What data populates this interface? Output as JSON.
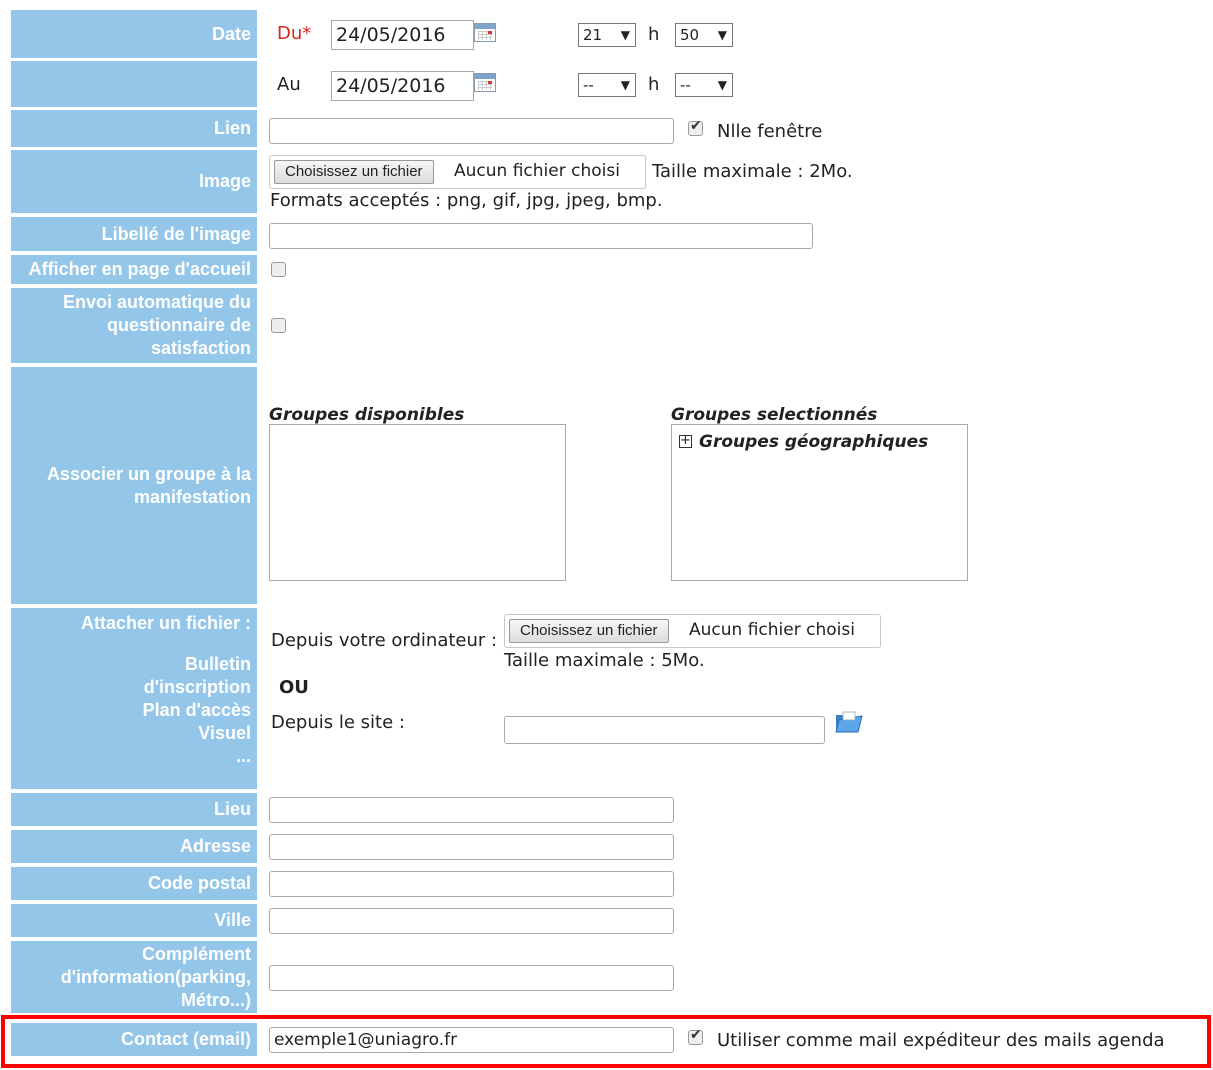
{
  "labels": {
    "date": "Date",
    "lien": "Lien",
    "image": "Image",
    "libelle_image": "Libellé de l'image",
    "afficher": "Afficher en page d'accueil",
    "envoi": [
      "Envoi automatique du",
      "questionnaire de",
      "satisfaction"
    ],
    "associer": [
      "Associer un groupe à la",
      "manifestation"
    ],
    "attacher": "Attacher un fichier :",
    "attacher_types": [
      "Bulletin",
      "d'inscription",
      "Plan d'accès",
      "Visuel",
      "..."
    ],
    "lieu": "Lieu",
    "adresse": "Adresse",
    "code_postal": "Code postal",
    "ville": "Ville",
    "complement": [
      "Complément",
      "d'information(parking,",
      "Métro...)"
    ],
    "contact": "Contact (email)"
  },
  "date": {
    "du_label": "Du*",
    "du_value": "24/05/2016",
    "du_hour": "21",
    "du_min": "50",
    "au_label": "Au",
    "au_value": "24/05/2016",
    "au_hour": "--",
    "au_min": "--",
    "h_sep": "h",
    "arrow": "▼"
  },
  "lien": {
    "value": "",
    "new_window_label": "Nlle fenêtre",
    "new_window_checked": true
  },
  "image": {
    "button": "Choisissez un fichier",
    "no_file": "Aucun fichier choisi",
    "max_size": "Taille maximale : 2Mo.",
    "formats": "Formats acceptés : png, gif, jpg, jpeg, bmp."
  },
  "afficher_checked": false,
  "envoi_checked": false,
  "groupes": {
    "available_title": "Groupes disponibles",
    "selected_title": "Groupes selectionnés",
    "selected_items": [
      "Groupes géographiques"
    ],
    "expand_symbol": "+"
  },
  "attach": {
    "from_computer": "Depuis votre ordinateur :",
    "button": "Choisissez un fichier",
    "no_file": "Aucun fichier choisi",
    "max_size": "Taille maximale : 5Mo.",
    "or": "OU",
    "from_site": "Depuis le site :"
  },
  "contact": {
    "value": "exemple1@uniagro.fr",
    "use_as_sender_label": "Utiliser comme mail expéditeur des mails agenda",
    "use_as_sender_checked": true
  }
}
